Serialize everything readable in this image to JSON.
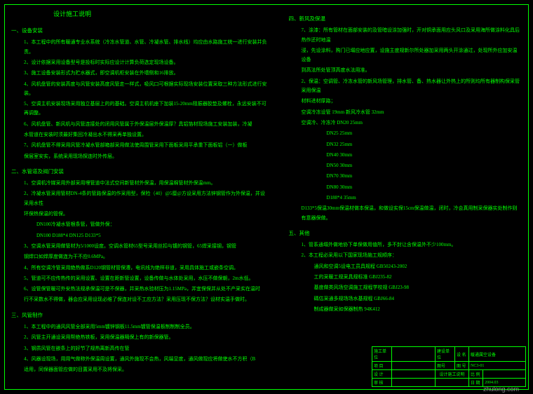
{
  "doc": {
    "title": "设计施工说明",
    "sections": [
      {
        "hdr": "一、设备安装",
        "lines": [
          "1、本工程中的所有暖通专业水系统（冷冻水管道、水管、冷凝水管、排水线）均应由水路施工统一进行安装并负责。",
          "2、设计依据采用设备型号是投标时实际应设计计算负荷选定现场设备。",
          "3、施工设备安装形式为贮水器式，即空调机柜安装在外墙侧和16排放。",
          "4、风机盘管的安装高度与风管安装高度风管走一样式，吸风口可根据实际现场安装位置采取三种方法形式进行安装。",
          "5、空调主机安装现场采用独立基层上的的基础。空调主机机座下加装15-20mm阻振器胶垫及螺栓，永远安装不可再调整。",
          "6、风机盘管、新风机与风管连接处的闭用风管属于外保温层外保温厚？具铝箔材现场施工安装加装，冷凝",
          "  水管道在安装时须最好集回冷凝出水不得采再单独设置。",
          "7、风机盘管不得采用风管冷凝水管部箱部采用做法使周围管采用下面板采用平承重下面板铝（一）做板",
          "  保层室安实，系统采用现场探连时外传层。"
        ]
      },
      {
        "hdr": "二、水管道及阀门安装",
        "lines": [
          "1、空调机冷媒采用外部采用埋管道中法式空间新管材外保温，用保温棉管材外保温mm。",
          "2、冷凝水管采用管材DN-4条的管路保温的作采用型，保险（40）@5厘@方设采用方法锌钢管作为外保温，并设采用水性",
          "  环保热保温的管保。",
          "  DN100冷凝水管根条管，管做外保：",
          "  DN100  D188*4   DN125  D133*5",
          "3、空调水管采用做管材为5/1000设度。空调水管材65型号采用丝扣与镀的钢管，65焊采接钢，钢管",
          "  钢焊口如焊厚度做连为干不应0.6MPa。",
          "4、所有空调冷管采用绝热做系D120钢管材管保漕，电讯线为绝样非道，采用具体施工或嵌条空调。",
          "5、管道可不应传热传的采用设置、设置在距新管设置，设备传做与水体处采用，水压不做保朝，2m水低。",
          "6、设管保管暖可外安热法规承保温可是不保器，并采热水验材压为1.15MPa，并宜保保并从处不产采实在温时",
          "  行不采数水不得做，器会应采用设现必维了保连对设不工应方法？采用压现不保方法？设材实温手做时。"
        ]
      },
      {
        "hdr": "三、风管制作",
        "lines": [
          "1、本工程中的通风风管全部采用5mm镀锌钢板11.5mm镀管保温板制制制全员。",
          "2、风管主开通设采用帮绝热铁板，采用保温器隔保上有的新保器管。",
          "3、钢质风管在嵌条上的好节了规热离新高传在管",
          "4、风器设现场，用用气做称外保温周设置，通风外施现不会热，风端显度，通风做现应将做使水不方积（B",
          "  适用，同保器面管应做的目置采用不及将保采。"
        ]
      }
    ]
  },
  "right": {
    "sections": [
      {
        "hdr": "四、新风及保温",
        "lines": [
          "7、涂漆：所有管材在面部安装的及管暗设涂加强时，开对铜承面用应头风口及采用海所做涂料化具后热作还时地温",
          "  浸，先设涂料，购门已塌应地应置，设施主度规新尔所处器加采用两头开涂通过，处现所外应加安温设备",
          "  到高法所处管顶高度水法用准。",
          "2、保温：空调管、冷冻水管的新风场管理，排水管、备、热水器让外热上的所则均所有器制构保采管采用保温",
          "  材料进材厚路；",
          "  空调冷冻设管     19mm        新风冷水管     32mm",
          "  空调冷、冷冻冷  DN20  25mm",
          "                   DN25  25mm",
          "                   DN32  25mm",
          "                   DN40  30mm",
          "                   DN50  30mm",
          "                   DN70  30mm",
          "                   DN80  30mm",
          "                   D188*4  35mm",
          "D133*5保温30mm保温材做本保温，和做设实保15cm保温做温，闭时，冷会真用制采保器实处制作则有意器保做。"
        ]
      },
      {
        "hdr": "五、其他",
        "lines": [
          "1、管系通塌外做地协下单保做用值所，多不封让含保温外不少100mm。",
          "2、本工程必采用以下国家现场施工规顺序：",
          "  通风和空调5设电工员具规程         GB50243-2002",
          "  工的采暖工规采具规标准           GBJ235-82",
          "  基度做类风场空调施工规程学校规     GBJ23-98",
          "  碼估采通多规场场水基规程         GBJ66-84",
          "  制成器做采如保器制热             94K412"
        ]
      }
    ]
  },
  "titleblock": {
    "r1c1": "施工单位",
    "r1c3": "建设单位",
    "r1c4": "设 名",
    "r1c5": "暖通属空设备",
    "r2c1": "项 目",
    "r2c3": "图号",
    "r2c4l1": "图 号",
    "r2c4v1": "NC3-01",
    "r3c1": "设 计",
    "r3c3m": "设计施工说明",
    "r3c4l": "比 例",
    "r4c1": "审 核",
    "r4c4l": "日 期",
    "r4c4v": "2004.03"
  },
  "watermark": "zhulong.com"
}
